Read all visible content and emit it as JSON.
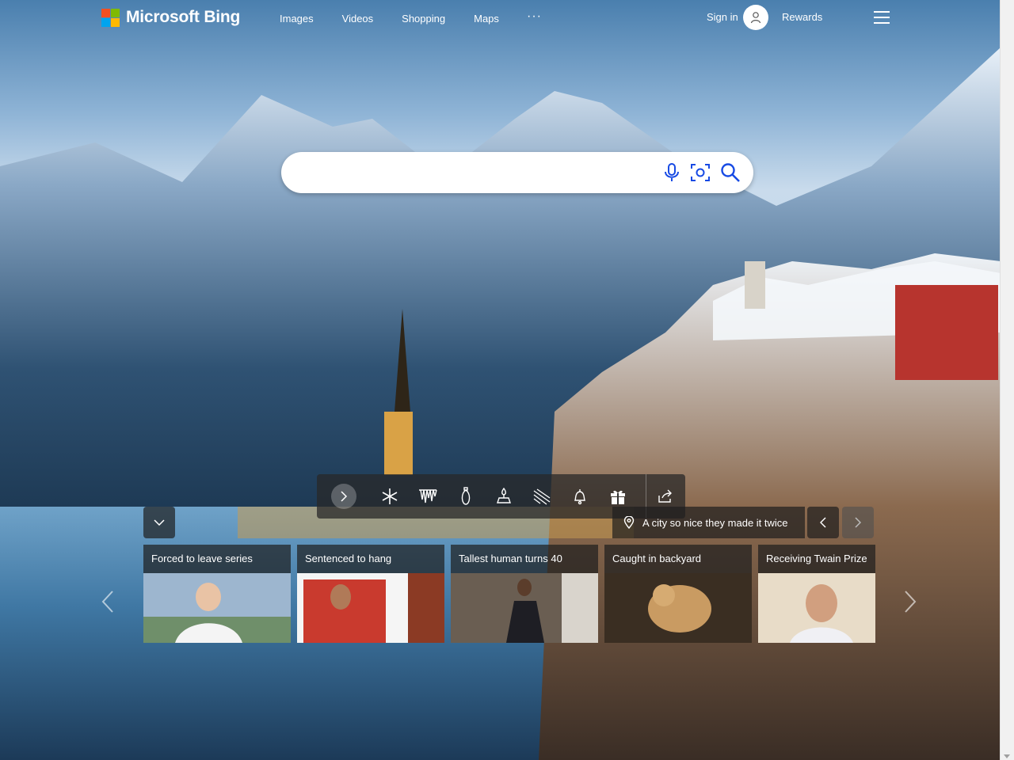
{
  "header": {
    "brand": "Microsoft Bing",
    "nav": [
      "Images",
      "Videos",
      "Shopping",
      "Maps"
    ],
    "more": "···",
    "signin": "Sign in",
    "rewards": "Rewards"
  },
  "colors": {
    "ms_red": "#f25022",
    "ms_green": "#7fba00",
    "ms_blue": "#00a4ef",
    "ms_yellow": "#ffb900"
  },
  "search": {
    "value": "",
    "placeholder": "",
    "icons": [
      "microphone-icon",
      "visual-search-icon",
      "search-icon"
    ]
  },
  "toolbar": {
    "icons": [
      "chevron-right-icon",
      "snowflake-icon",
      "icicles-icon",
      "ornament-icon",
      "candle-icon",
      "snow-flurry-icon",
      "bell-icon",
      "gift-icon",
      "share-icon"
    ]
  },
  "image_info": {
    "location_text": "A city so nice they made it twice"
  },
  "news": [
    {
      "title": "Forced to leave series"
    },
    {
      "title": "Sentenced to hang"
    },
    {
      "title": "Tallest human turns 40"
    },
    {
      "title": "Caught in backyard"
    },
    {
      "title": "Receiving Twain Prize"
    }
  ]
}
